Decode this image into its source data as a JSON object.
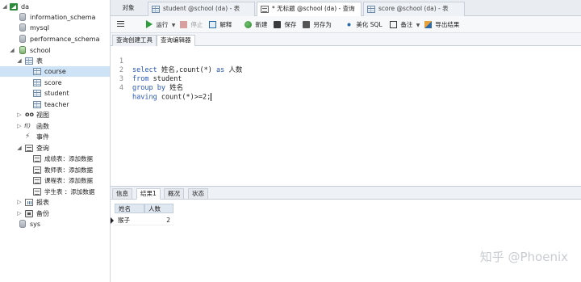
{
  "sidebar": {
    "connection": "da",
    "databases": [
      "information_schema",
      "mysql",
      "performance_schema",
      "school"
    ],
    "school": {
      "tables_group": "表",
      "tables": [
        "course",
        "score",
        "student",
        "teacher"
      ],
      "selected_table": "course",
      "views": "视图",
      "functions": "函数",
      "events": "事件",
      "queries_group": "查询",
      "queries": [
        "成绩表：添加数据",
        "教师表：添加数据",
        "课程表：添加数据",
        "学生表 ：添加数据"
      ],
      "reports": "报表",
      "backups": "备份"
    },
    "other_db": "sys"
  },
  "tabs": [
    {
      "label": "对象",
      "icon": "none"
    },
    {
      "label": "student @school (da) - 表",
      "icon": "table-icon"
    },
    {
      "label": "* 无标题 @school (da) - 查询",
      "icon": "query-icon"
    },
    {
      "label": "score @school (da) - 表",
      "icon": "table-icon"
    }
  ],
  "toolbar": {
    "run": "运行",
    "stop": "停止",
    "explain": "解释",
    "new": "新建",
    "save": "保存",
    "save_as": "另存为",
    "beautify": "美化 SQL",
    "note": "备注",
    "export": "导出结果"
  },
  "subtabs": [
    "查询创建工具",
    "查询编辑器"
  ],
  "editor": {
    "lines": [
      {
        "n": "1",
        "k1": "select",
        "t1": " 姓名,count(*) ",
        "k2": "as",
        "t2": " 人数"
      },
      {
        "n": "2",
        "k1": "from",
        "t1": " student",
        "k2": "",
        "t2": ""
      },
      {
        "n": "3",
        "k1": "group by",
        "t1": " 姓名",
        "k2": "",
        "t2": ""
      },
      {
        "n": "4",
        "k1": "having",
        "t1": " count(*)>=2;",
        "k2": "",
        "t2": ""
      }
    ]
  },
  "result_tabs": [
    "信息",
    "结果1",
    "概况",
    "状态"
  ],
  "grid": {
    "columns": [
      "姓名",
      "人数"
    ],
    "rows": [
      [
        "猴子",
        "2"
      ]
    ]
  },
  "watermark": "知乎 @Phoenix",
  "colors": {
    "keyword": "#2756b5",
    "run": "#2e9d3b",
    "selection": "#cfe3f6"
  }
}
